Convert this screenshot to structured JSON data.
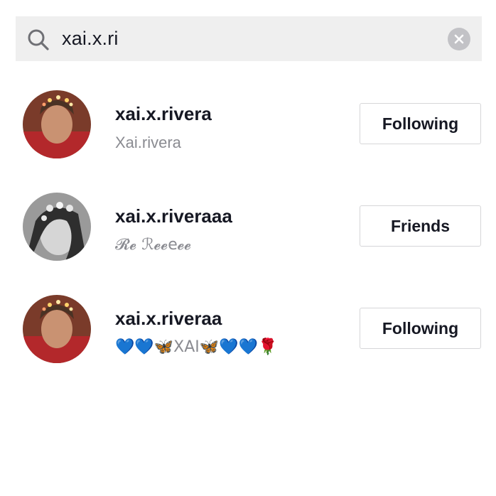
{
  "search": {
    "query": "xai.x.ri",
    "search_icon": "search-icon",
    "clear_icon": "clear-icon"
  },
  "results": [
    {
      "username": "xai.x.rivera",
      "nickname": "Xai.rivera",
      "button_label": "Following"
    },
    {
      "username": "xai.x.riveraaa",
      "nickname": "𝓡𝓮 ℛ𝓮𝓮e𝓮𝓮",
      "button_label": "Friends"
    },
    {
      "username": "xai.x.riveraa",
      "nickname": "💙💙🦋XAI🦋💙💙🌹",
      "button_label": "Following"
    }
  ],
  "colors": {
    "search_bg": "#efefef",
    "text_primary": "#161823",
    "text_secondary": "#8a8b91",
    "button_border": "#d6d6d8",
    "heart_blue": "#a7daf7",
    "butterfly": "#f2b8a0"
  }
}
